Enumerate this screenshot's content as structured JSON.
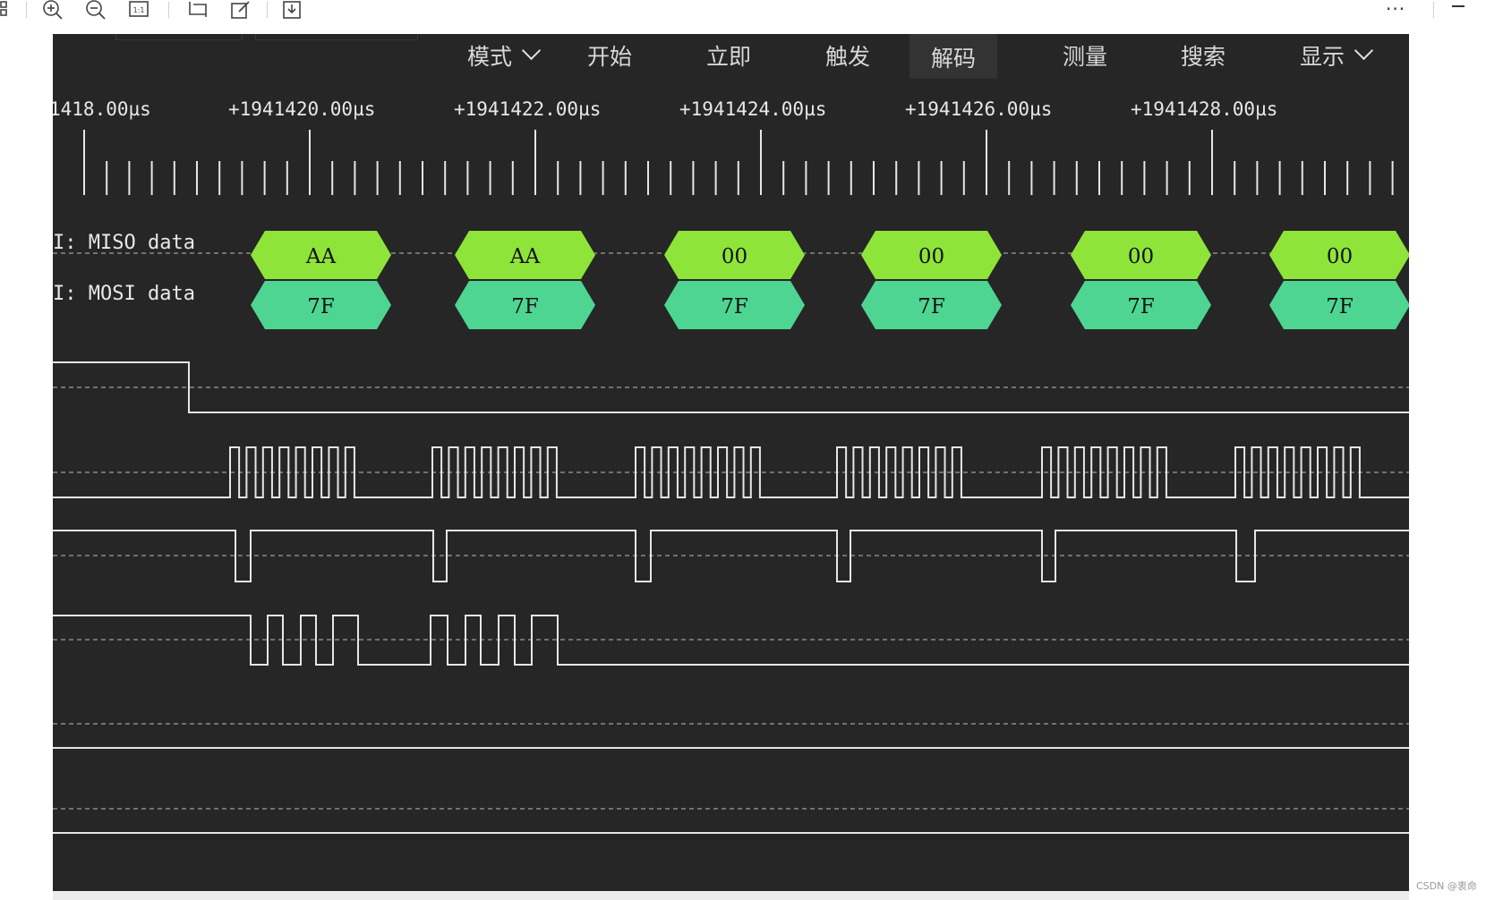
{
  "toolbar": {
    "icons": [
      "grid-icon",
      "zoom-in-icon",
      "zoom-out-icon",
      "fit-icon",
      "crop-icon",
      "edit-icon",
      "download-icon"
    ],
    "more_label": "···"
  },
  "menu": {
    "items": [
      {
        "label": "模式",
        "has_dropdown": true
      },
      {
        "label": "开始"
      },
      {
        "label": "立即"
      },
      {
        "label": "触发"
      },
      {
        "label": "解码",
        "active": true
      },
      {
        "label": "测量"
      },
      {
        "label": "搜索"
      },
      {
        "label": "显示",
        "has_dropdown": true
      }
    ]
  },
  "timeline": {
    "labels": [
      "1418.00µs",
      "+1941420.00µs",
      "+1941422.00µs",
      "+1941424.00µs",
      "+1941426.00µs",
      "+1941428.00µs"
    ]
  },
  "decoder": {
    "miso_label": "I: MISO data",
    "mosi_label": "I: MOSI data",
    "miso_values": [
      "AA",
      "AA",
      "00",
      "00",
      "00",
      "00"
    ],
    "mosi_values": [
      "7F",
      "7F",
      "7F",
      "7F",
      "7F",
      "7F"
    ]
  },
  "colors": {
    "background": "#262626",
    "miso_fill": "#8fe43a",
    "mosi_fill": "#4fd592",
    "trace": "#e6e6e6",
    "grid_dash": "#8a8a8a"
  },
  "watermark": "CSDN @衷命"
}
